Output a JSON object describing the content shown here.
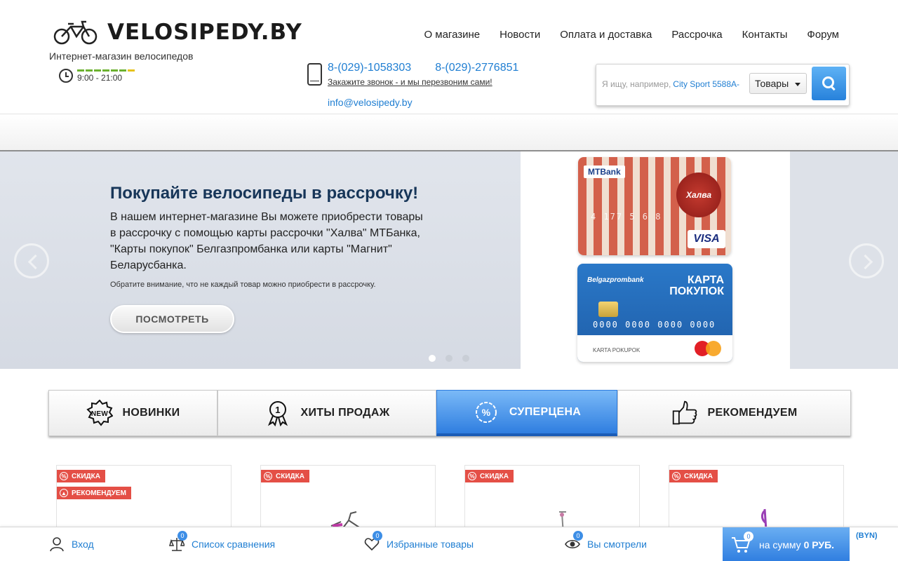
{
  "header": {
    "logo_text": "VELOSIPEDY.BY",
    "tagline": "Интернет-магазин велосипедов",
    "hours": "9:00 - 21:00",
    "nav": [
      "О магазине",
      "Новости",
      "Оплата и доставка",
      "Рассрочка",
      "Контакты",
      "Форум"
    ],
    "phones": [
      "8-(029)-1058303",
      "8-(029)-2776851"
    ],
    "callback_text": "Закажите звонок - и мы перезвоним сами!",
    "email": "info@velosipedy.by",
    "search": {
      "placeholder_hint": "Я ищу, например,",
      "placeholder_example": "City Sport 5588A-",
      "category": "Товары"
    }
  },
  "slider": {
    "title": "Покупайте велосипеды в рассрочку!",
    "text": "В нашем интернет-магазине Вы можете приобрести товары в рассрочку с помощью карты рассрочки \"Халва\" МТБанка, \"Карты покупок\" Белгазпромбанка или карты \"Магнит\" Беларусбанка.",
    "note": "Обратите внимание, что не каждый товар можно приобрести в рассрочку.",
    "button": "ПОСМОТРЕТЬ",
    "dots": 3,
    "active_dot": 0,
    "cards": {
      "halva": {
        "bank": "MTBank",
        "seal": "Халва",
        "number": "4 177  5  6  8",
        "brand": "VISA"
      },
      "pokupok": {
        "bank": "Belgazprombank",
        "title_line1": "КАРТА",
        "title_line2": "ПОКУПОК",
        "number": "0000 0000 0000 0000",
        "holder": "KARTA POKUPOK",
        "brand": "MasterCard"
      }
    }
  },
  "tabs": [
    {
      "label": "НОВИНКИ",
      "icon": "new-badge-icon",
      "active": false
    },
    {
      "label": "ХИТЫ ПРОДАЖ",
      "icon": "award-icon",
      "active": false
    },
    {
      "label": "СУПЕРЦЕНА",
      "icon": "percent-icon",
      "active": true
    },
    {
      "label": "РЕКОМЕНДУЕМ",
      "icon": "thumbs-up-icon",
      "active": false
    }
  ],
  "products": [
    {
      "badges": [
        "СКИДКА",
        "РЕКОМЕНДУЕМ"
      ]
    },
    {
      "badges": [
        "СКИДКА"
      ]
    },
    {
      "badges": [
        "СКИДКА"
      ]
    },
    {
      "badges": [
        "СКИДКА"
      ]
    }
  ],
  "bottom_bar": {
    "login": "Вход",
    "compare": "Список сравнения",
    "compare_count": "0",
    "favorites": "Избранные товары",
    "favorites_count": "0",
    "viewed": "Вы смотрели",
    "viewed_count": "0",
    "cart_count": "0",
    "cart_prefix": "на сумму",
    "cart_sum": "0 РУБ.",
    "currency": "(BYN)"
  },
  "colors": {
    "accent": "#2f7ee0",
    "link": "#1f7ed2",
    "badge": "#e44f46",
    "title": "#173659"
  }
}
